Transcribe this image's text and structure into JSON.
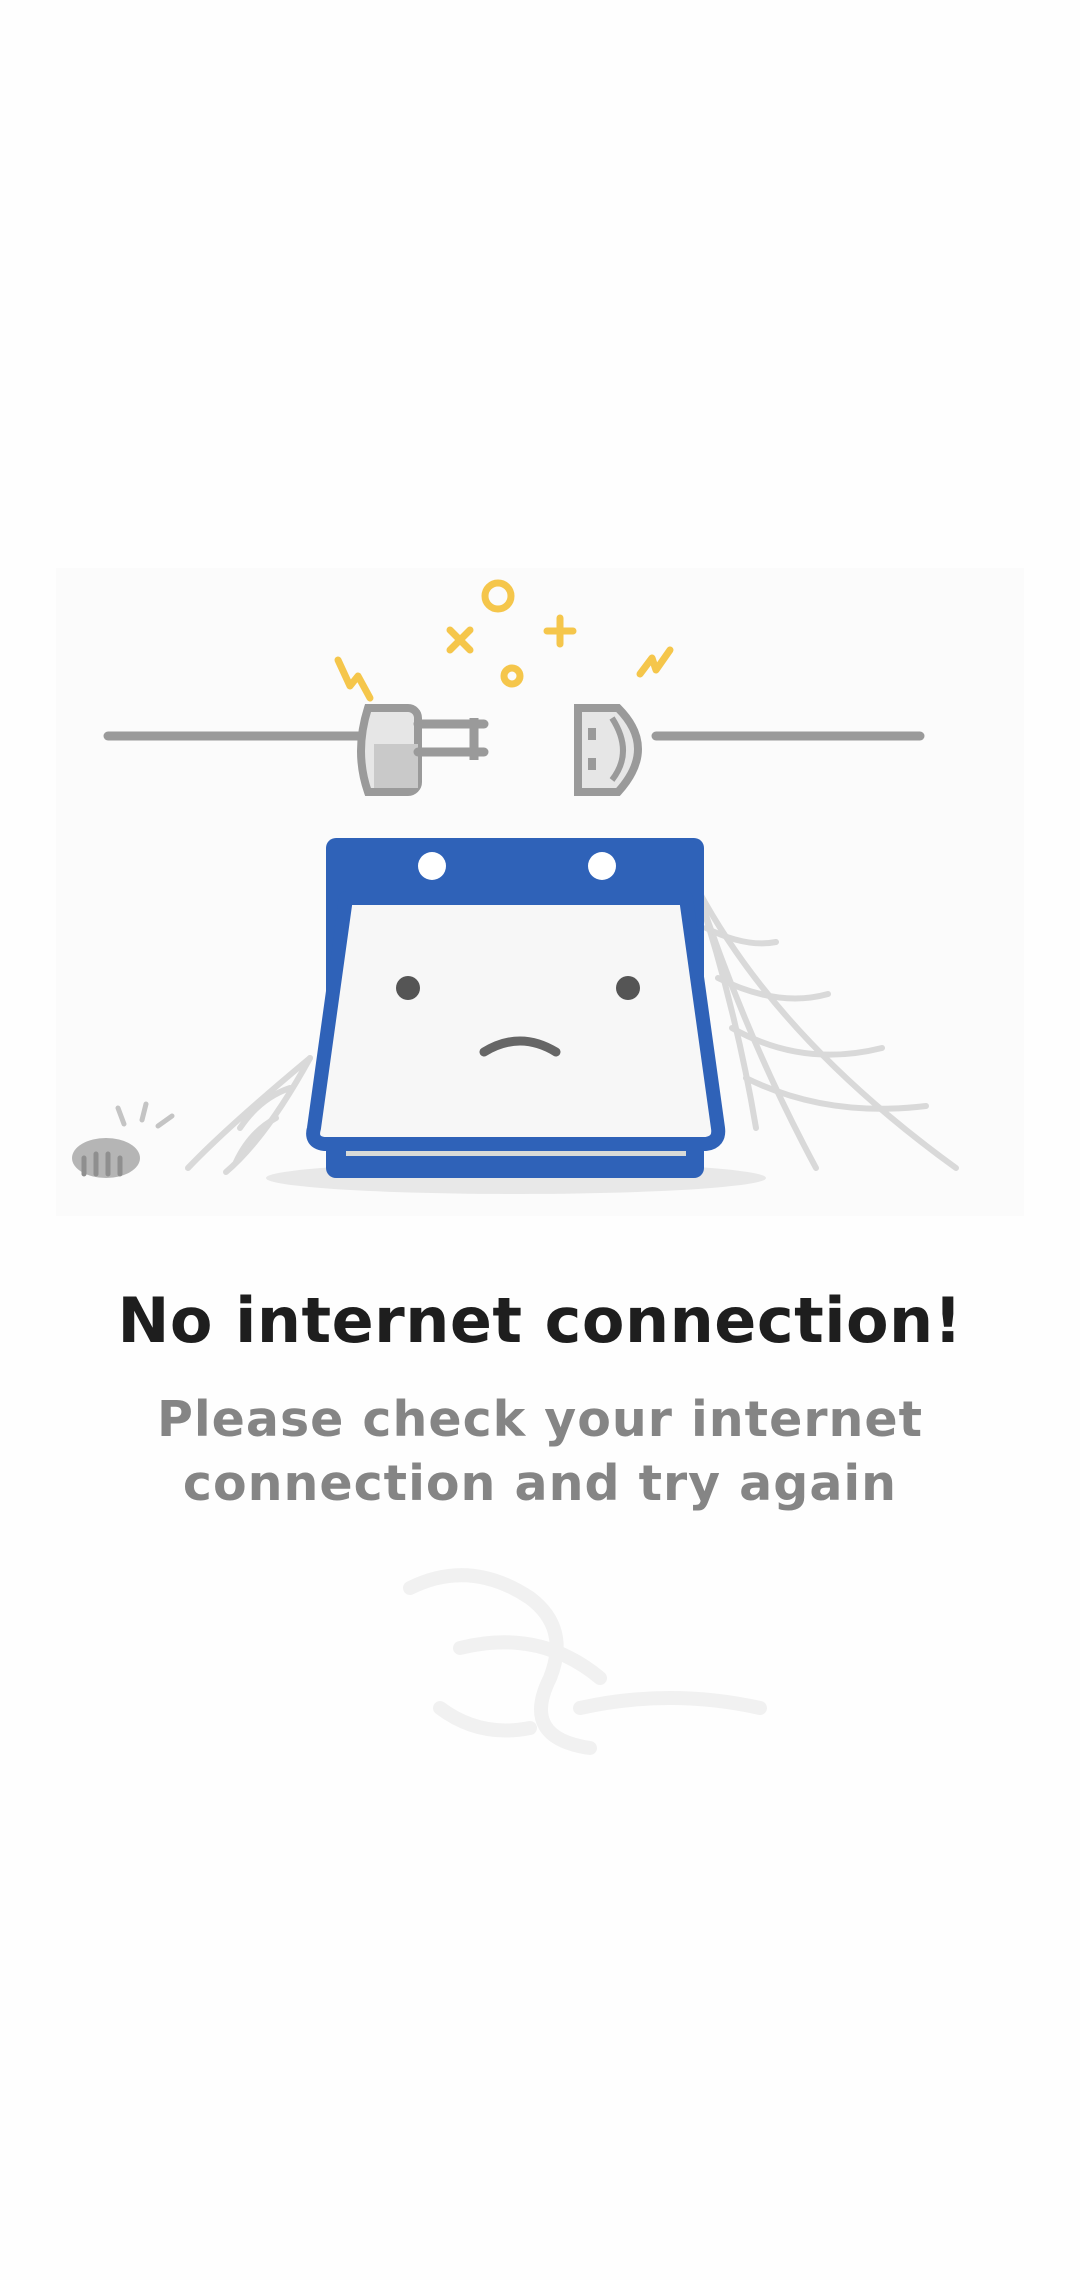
{
  "error": {
    "title": "No internet connection!",
    "message": "Please check your internet connection and try again"
  },
  "illustration": {
    "subject": "unplugged-cable-and-sad-calendar",
    "colors": {
      "calendar_blue": "#2f62b8",
      "spark_yellow": "#f5c64b",
      "cable_gray": "#9a9a9a",
      "web_gray": "#d6d6d6"
    }
  },
  "watermark": {
    "icon": "faint-scribble-watermark"
  }
}
